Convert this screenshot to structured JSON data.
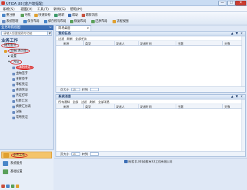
{
  "window": {
    "title": "UFIDA U8 [客户端提醒]",
    "min": "—",
    "max": "□",
    "close": "✕"
  },
  "menu": [
    "系统(S)",
    "视图(V)",
    "工具(T)",
    "转到(G)",
    "帮助(H)"
  ],
  "toolbar": {
    "row1": [
      "重注册",
      "导航",
      "快速架构",
      "刷新",
      "帮助",
      "最新消息"
    ],
    "row2": [
      "系统管理",
      "保存布局",
      "保存所有布局",
      "恢复布局",
      "还原布局",
      "流程视图"
    ]
  },
  "sidebar": {
    "header": "业务导航视图",
    "pin": "×",
    "search_placeholder": "请输入您要搜索的功能",
    "search_btn": "▼",
    "section": "业务工作",
    "tree": [
      {
        "label": "财务会计",
        "highlight": "outline"
      },
      {
        "label": "总账[演示版]",
        "highlight": "outline"
      },
      {
        "label": "设置",
        "highlight": "none"
      },
      {
        "label": "凭证",
        "highlight": "outline"
      },
      {
        "label": "填制凭证",
        "highlight": "fill"
      },
      {
        "label": "出纳签字",
        "highlight": "none"
      },
      {
        "label": "主管签字",
        "highlight": "none"
      },
      {
        "label": "审核凭证",
        "highlight": "none"
      },
      {
        "label": "查询凭证",
        "highlight": "none"
      },
      {
        "label": "凭证打印",
        "highlight": "none"
      },
      {
        "label": "科目汇总",
        "highlight": "none"
      },
      {
        "label": "摘要汇总表",
        "highlight": "none"
      },
      {
        "label": "记账",
        "highlight": "none"
      },
      {
        "label": "常用凭证",
        "highlight": "none"
      }
    ],
    "tabs": [
      "业务工作",
      "系统服务",
      "基础设置"
    ]
  },
  "main": {
    "doc_tab": "简易桌面",
    "doc_tab_close": "×",
    "panel1": {
      "title": "我的任务",
      "controls": "▲ ▼ ✕",
      "toolbar": [
        "过滤",
        "刷新",
        "全部任务"
      ],
      "columns": [
        "来源",
        "类型",
        "发送人",
        "发送时间",
        "主题",
        "天数"
      ],
      "footer": {
        "page_label": "页大小",
        "page_size": "15",
        "goto_label": "转到"
      }
    },
    "panel2": {
      "title": "系统消息",
      "controls": "▲ ▼ ✕",
      "toolbar": [
        "所有通知",
        "全部",
        "过滤",
        "刷新",
        "全部消息"
      ],
      "columns": [
        "来源",
        "类型",
        "发送人",
        "发送时间",
        "主题",
        "天数"
      ],
      "footer": {
        "page_label": "页大小",
        "page_size": "15",
        "goto_label": "转到"
      }
    }
  },
  "status": {
    "text": "账套:[100]成都市XX工程有限公司"
  },
  "colors": {
    "accent": "#3d6fb5",
    "highlight": "#d21f1f",
    "active_tab": "#f4c46a"
  }
}
